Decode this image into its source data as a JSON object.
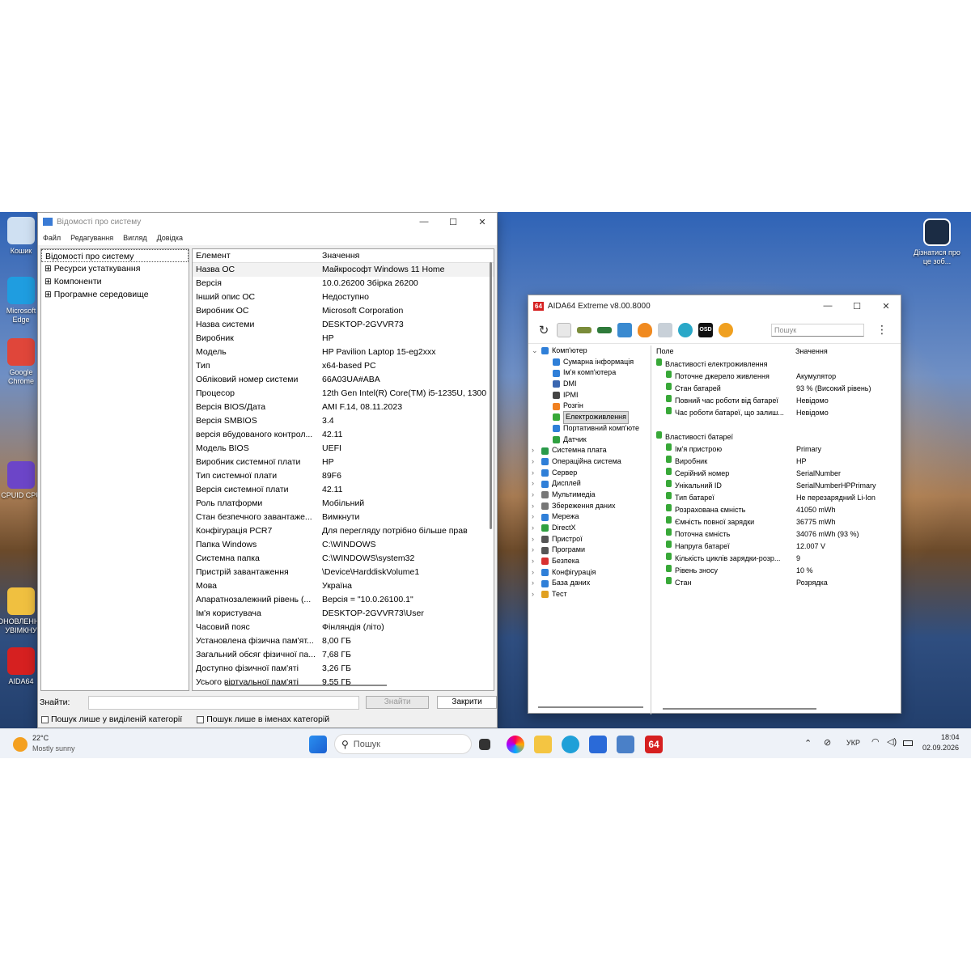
{
  "desktop": {
    "icons": [
      {
        "label": "Кошик",
        "color": "#cfe0f2"
      },
      {
        "label": "Microsoft Edge",
        "color": "#1f9de0"
      },
      {
        "label": "Google Chrome",
        "color": "#e0463a"
      },
      {
        "label": "CPUID CPU",
        "color": "#6c45c8"
      },
      {
        "label": "ОНОВЛЕННЯ УВІМКНУ",
        "color": "#f0c040"
      },
      {
        "label": "AIDA64",
        "color": "#d62020"
      }
    ],
    "corner_icon_label": "Дізнатися про це зоб..."
  },
  "msinfo": {
    "title": "Відомості про систему",
    "menu": [
      "Файл",
      "Редагування",
      "Вигляд",
      "Довідка"
    ],
    "tree": [
      {
        "label": "Відомості про систему",
        "prefix": ""
      },
      {
        "label": "Ресурси устаткування",
        "prefix": "⊞ "
      },
      {
        "label": "Компоненти",
        "prefix": "⊞ "
      },
      {
        "label": "Програмне середовище",
        "prefix": "⊞ "
      }
    ],
    "columns": [
      "Елемент",
      "Значення"
    ],
    "rows": [
      [
        "Назва ОС",
        "Майкрософт Windows 11 Home"
      ],
      [
        "Версія",
        "10.0.26200 Збірка 26200"
      ],
      [
        "Інший опис ОС",
        "Недоступно"
      ],
      [
        "Виробник ОС",
        "Microsoft Corporation"
      ],
      [
        "Назва системи",
        "DESKTOP-2GVVR73"
      ],
      [
        "Виробник",
        "HP"
      ],
      [
        "Модель",
        "HP Pavilion Laptop 15-eg2xxx"
      ],
      [
        "Тип",
        "x64-based PC"
      ],
      [
        "Обліковий номер системи",
        "66A03UA#ABA"
      ],
      [
        "Процесор",
        "12th Gen Intel(R) Core(TM) i5-1235U, 1300"
      ],
      [
        "Версія BIOS/Дата",
        "AMI F.14, 08.11.2023"
      ],
      [
        "Версія SMBIOS",
        "3.4"
      ],
      [
        "версія вбудованого контрол...",
        "42.11"
      ],
      [
        "Модель BIOS",
        "UEFI"
      ],
      [
        "Виробник системної плати",
        "HP"
      ],
      [
        "Тип системної плати",
        "89F6"
      ],
      [
        "Версія системної плати",
        "42.11"
      ],
      [
        "Роль платформи",
        "Мобільний"
      ],
      [
        "Стан безпечного завантаже...",
        "Вимкнути"
      ],
      [
        "Конфігурація PCR7",
        "Для перегляду потрібно більше прав"
      ],
      [
        "Папка Windows",
        "C:\\WINDOWS"
      ],
      [
        "Системна папка",
        "C:\\WINDOWS\\system32"
      ],
      [
        "Пристрій завантаження",
        "\\Device\\HarddiskVolume1"
      ],
      [
        "Мова",
        "Україна"
      ],
      [
        "Апаратнозалежний рівень (...",
        "Версія = \"10.0.26100.1\""
      ],
      [
        "Ім'я користувача",
        "DESKTOP-2GVVR73\\User"
      ],
      [
        "Часовий пояс",
        "Фінляндія (літо)"
      ],
      [
        "Установлена фізична пам'ят...",
        "8,00 ГБ"
      ],
      [
        "Загальний обсяг фізичної па...",
        "7,68 ГБ"
      ],
      [
        "Доступно фізичної пам'яті",
        "3,26 ГБ"
      ],
      [
        "Усього віртуальної пам'яті",
        "9,55 ГБ"
      ]
    ],
    "find_label": "Знайти:",
    "find_value": "",
    "find_button": "Знайти",
    "close_button": "Закрити",
    "opt1": "Пошук лише у виділеній категорії",
    "opt2": "Пошук лише в іменах категорій"
  },
  "aida": {
    "title": "AIDA64 Extreme v8.00.8000",
    "logo": "64",
    "search_placeholder": "Пошук",
    "tree": [
      {
        "label": "Комп'ютер",
        "lvl": 0,
        "color": "#2f7fd8",
        "arrow": "⌄"
      },
      {
        "label": "Сумарна інформація",
        "lvl": 1,
        "color": "#2f7fd8"
      },
      {
        "label": "Ім'я комп'ютера",
        "lvl": 1,
        "color": "#2f7fd8"
      },
      {
        "label": "DMI",
        "lvl": 1,
        "color": "#3a66b0"
      },
      {
        "label": "IPMI",
        "lvl": 1,
        "color": "#444"
      },
      {
        "label": "Розгін",
        "lvl": 1,
        "color": "#f08020"
      },
      {
        "label": "Електроживлення",
        "lvl": 1,
        "color": "#38a838",
        "sel": true
      },
      {
        "label": "Портативний комп'юте",
        "lvl": 1,
        "color": "#2f7fd8"
      },
      {
        "label": "Датчик",
        "lvl": 1,
        "color": "#2fa040"
      },
      {
        "label": "Системна плата",
        "lvl": 0,
        "color": "#2a9a4a",
        "arrow": "›"
      },
      {
        "label": "Операційна система",
        "lvl": 0,
        "color": "#2f7fd8",
        "arrow": "›"
      },
      {
        "label": "Сервер",
        "lvl": 0,
        "color": "#2f7fd8",
        "arrow": "›"
      },
      {
        "label": "Дисплей",
        "lvl": 0,
        "color": "#2f7fd8",
        "arrow": "›"
      },
      {
        "label": "Мультимедіа",
        "lvl": 0,
        "color": "#777",
        "arrow": "›"
      },
      {
        "label": "Збереження даних",
        "lvl": 0,
        "color": "#777",
        "arrow": "›"
      },
      {
        "label": "Мережа",
        "lvl": 0,
        "color": "#2f7fd8",
        "arrow": "›"
      },
      {
        "label": "DirectX",
        "lvl": 0,
        "color": "#2fa040",
        "arrow": "›"
      },
      {
        "label": "Пристрої",
        "lvl": 0,
        "color": "#555",
        "arrow": "›"
      },
      {
        "label": "Програми",
        "lvl": 0,
        "color": "#555",
        "arrow": "›"
      },
      {
        "label": "Безпека",
        "lvl": 0,
        "color": "#d83030",
        "arrow": "›"
      },
      {
        "label": "Конфігурація",
        "lvl": 0,
        "color": "#2f7fd8",
        "arrow": "›"
      },
      {
        "label": "База даних",
        "lvl": 0,
        "color": "#2f7fd8",
        "arrow": "›"
      },
      {
        "label": "Тест",
        "lvl": 0,
        "color": "#e0a020",
        "arrow": "›"
      }
    ],
    "columns": [
      "Поле",
      "Значення"
    ],
    "rows": [
      {
        "k": "Властивості електроживлення",
        "v": "",
        "group": true
      },
      {
        "k": "Поточне джерело живлення",
        "v": "Акумулятор"
      },
      {
        "k": "Стан батарей",
        "v": "93 % (Високий рівень)"
      },
      {
        "k": "Повний час роботи від батареї",
        "v": "Невідомо"
      },
      {
        "k": "Час роботи батареї, що залиш...",
        "v": "Невідомо"
      },
      {
        "k": "",
        "v": "",
        "blank": true
      },
      {
        "k": "Властивості батареї",
        "v": "",
        "group": true
      },
      {
        "k": "Ім'я пристрою",
        "v": "Primary"
      },
      {
        "k": "Виробник",
        "v": "HP"
      },
      {
        "k": "Серійний номер",
        "v": "SerialNumber"
      },
      {
        "k": "Унікальний ID",
        "v": "SerialNumberHPPrimary"
      },
      {
        "k": "Тип батареї",
        "v": "Не перезарядний Li-Ion"
      },
      {
        "k": "Розрахована ємність",
        "v": "41050 mWh"
      },
      {
        "k": "Ємність повної зарядки",
        "v": "36775 mWh"
      },
      {
        "k": "Поточна ємність",
        "v": "34076 mWh  (93 %)"
      },
      {
        "k": "Напруга батареї",
        "v": "12.007 V"
      },
      {
        "k": "Кількість циклів зарядки-розр...",
        "v": "9"
      },
      {
        "k": "Рівень зносу",
        "v": "10 %"
      },
      {
        "k": "Стан",
        "v": "Розрядка"
      }
    ]
  },
  "taskbar": {
    "weather_temp": "22°C",
    "weather_text": "Mostly sunny",
    "search_placeholder": "Пошук",
    "lang": "УКР",
    "time": "18:04",
    "date": "02.09.2026"
  }
}
